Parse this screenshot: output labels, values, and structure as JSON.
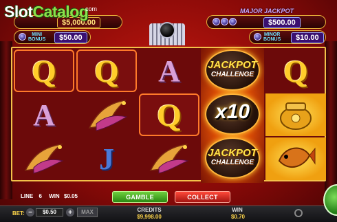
{
  "logo": {
    "text_a": "Slot",
    "text_b": "Catalog",
    "suffix": "com"
  },
  "jackpots": {
    "grand_value": "$5,000.00",
    "mini_label": "MINI",
    "mini_sub": "BONUS",
    "mini_value": "$50.00",
    "major_label": "MAJOR JACKPOT",
    "major_value": "$500.00",
    "minor_label": "MINOR",
    "minor_sub": "BONUS",
    "minor_value": "$10.00"
  },
  "reels": {
    "jackpot_line1": "JACKPOT",
    "jackpot_line2": "CHALLENGE",
    "multiplier": "x10",
    "symbols": {
      "queen": "Q",
      "ace": "A",
      "jack": "J"
    }
  },
  "status": {
    "line_label": "LINE",
    "line_value": "6",
    "win_label": "WIN",
    "win_value": "$0.05"
  },
  "buttons": {
    "gamble": "GAMBLE",
    "collect": "COLLECT",
    "max": "MAX",
    "minus": "−",
    "plus": "+"
  },
  "footer": {
    "bet_label": "BET:",
    "bet_value": "$0.50",
    "credits_label": "CREDITS",
    "credits_value": "$9,998.00",
    "win_label": "WIN",
    "win_value": "$0.70"
  },
  "icons": [
    "settings-icon",
    "spin-button-icon"
  ],
  "colors": {
    "accent_gold": "#f2c14a",
    "gamble_green": "#2a8a12",
    "collect_red": "#a51410"
  }
}
